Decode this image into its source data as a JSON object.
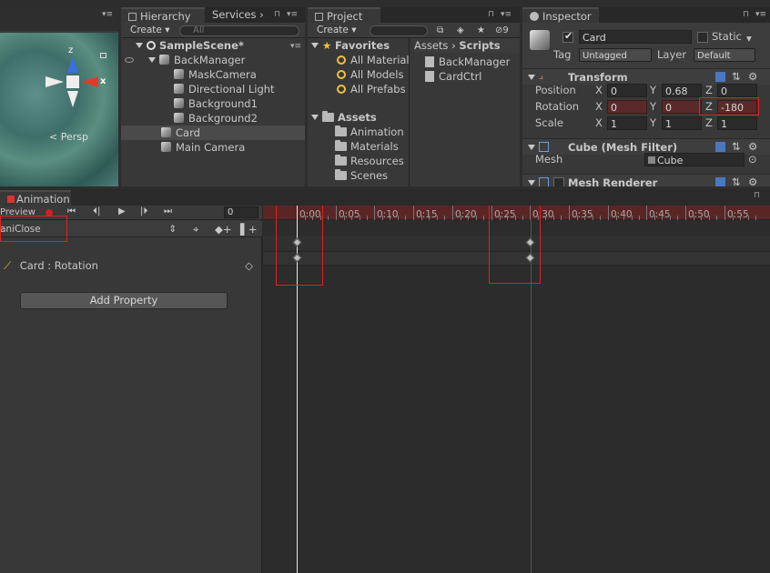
{
  "scene": {
    "gizmo_labels": {
      "z": "z",
      "x": "x"
    },
    "persp_label": "< Persp"
  },
  "hierarchy": {
    "tab_label": "Hierarchy",
    "services_label": "Services",
    "create_label": "Create",
    "search_placeholder": "All",
    "scene_name": "SampleScene*",
    "items": [
      {
        "label": "BackManager"
      },
      {
        "label": "MaskCamera"
      },
      {
        "label": "Directional Light"
      },
      {
        "label": "Background1"
      },
      {
        "label": "Background2"
      },
      {
        "label": "Card"
      },
      {
        "label": "Main Camera"
      }
    ]
  },
  "project": {
    "tab_label": "Project",
    "create_label": "Create",
    "search_badge": "9",
    "favorites_label": "Favorites",
    "favorites": [
      "All Material",
      "All Models",
      "All Prefabs"
    ],
    "assets_label": "Assets",
    "folders": [
      "Animation",
      "Materials",
      "Resources",
      "Scenes"
    ],
    "breadcrumb": {
      "root": "Assets",
      "current": "Scripts"
    },
    "scripts": [
      "BackManager",
      "CardCtrl"
    ]
  },
  "inspector": {
    "tab_label": "Inspector",
    "object_name": "Card",
    "static_label": "Static",
    "tag_label": "Tag",
    "tag_value": "Untagged",
    "layer_label": "Layer",
    "layer_value": "Default",
    "transform": {
      "title": "Transform",
      "position": {
        "label": "Position",
        "x": "0",
        "y": "0.68",
        "z": "0"
      },
      "rotation": {
        "label": "Rotation",
        "x": "0",
        "y": "0",
        "z": "-180"
      },
      "scale": {
        "label": "Scale",
        "x": "1",
        "y": "1",
        "z": "1"
      },
      "axis": {
        "x": "X",
        "y": "Y",
        "z": "Z"
      }
    },
    "mesh_filter": {
      "title": "Cube (Mesh Filter)",
      "mesh_label": "Mesh",
      "mesh_value": "Cube"
    },
    "mesh_renderer": {
      "title": "Mesh Renderer"
    }
  },
  "animation": {
    "tab_label": "Animation",
    "preview_label": "Preview",
    "frame_value": "0",
    "clip_name": "aniClose",
    "property_label": "Card : Rotation",
    "add_property_label": "Add Property",
    "time_labels": [
      "0:00",
      "0:05",
      "0:10",
      "0:15",
      "0:20",
      "0:25",
      "0:30",
      "0:35",
      "0:40",
      "0:45",
      "0:50",
      "0:55"
    ]
  },
  "colors": {
    "highlight_red": "#e02020",
    "animated_field": "#5a2a2a",
    "timeline_red": "#5a2525"
  }
}
